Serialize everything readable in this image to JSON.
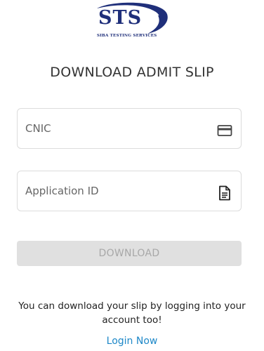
{
  "logo": {
    "text": "STS",
    "subtitle": "SIBA TESTING SERVICES"
  },
  "title": "DOWNLOAD ADMIT SLIP",
  "fields": {
    "cnic": {
      "placeholder": "CNIC",
      "icon": "credit-card-icon"
    },
    "application_id": {
      "placeholder": "Application ID",
      "icon": "document-icon"
    }
  },
  "download_button": {
    "label": "DOWNLOAD",
    "state": "disabled"
  },
  "note": "You can download your slip by logging into your account too!",
  "login_link": "Login Now",
  "colors": {
    "brand": "#1f2f7a",
    "link": "#1e88c8",
    "button_disabled_bg": "#e0e0e0",
    "button_disabled_text": "#a8a8a8"
  }
}
